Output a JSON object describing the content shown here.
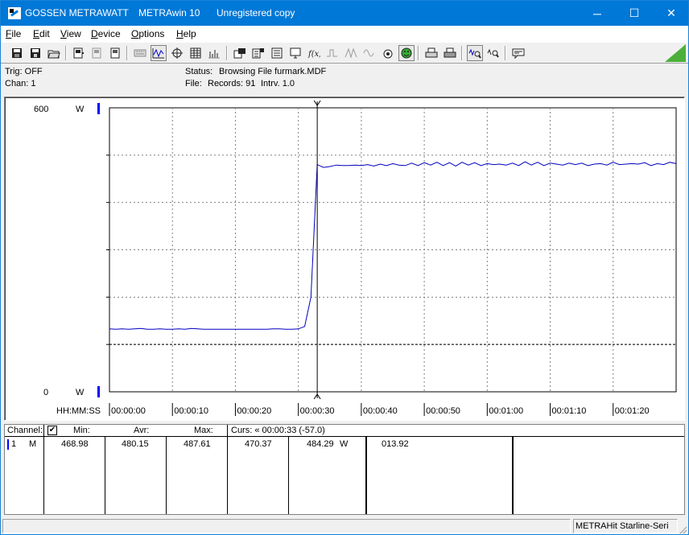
{
  "window": {
    "title_parts": [
      "GOSSEN METRAWATT",
      "METRAwin 10",
      "Unregistered copy"
    ],
    "controls": {
      "minimize": "─",
      "maximize": "☐",
      "close": "✕"
    }
  },
  "menu": [
    {
      "label": "File",
      "key": "F",
      "rest": "ile"
    },
    {
      "label": "Edit",
      "key": "E",
      "rest": "dit"
    },
    {
      "label": "View",
      "key": "V",
      "rest": "iew"
    },
    {
      "label": "Device",
      "key": "D",
      "rest": "evice"
    },
    {
      "label": "Options",
      "key": "O",
      "rest": "ptions"
    },
    {
      "label": "Help",
      "key": "H",
      "rest": "elp"
    }
  ],
  "toolbar": {
    "icons": [
      "save-icon",
      "save-as-icon",
      "open-icon",
      "device-icon",
      "device-2-icon",
      "device-3-icon",
      "keyboard-icon",
      "waveform-icon",
      "crosshair-icon",
      "table-icon",
      "bars-icon",
      "export-icon",
      "export-2-icon",
      "list-icon",
      "monitor-icon",
      "function-icon",
      "trigger-icon",
      "peak-icon",
      "sine-icon",
      "camera-icon",
      "smiley-icon",
      "print-icon",
      "print-2-icon",
      "zoom-icon",
      "zoom-2-icon",
      "comment-icon"
    ],
    "pressed": [
      "waveform-icon",
      "smiley-icon",
      "zoom-icon"
    ]
  },
  "status": {
    "trig": "Trig: OFF",
    "chan": "Chan:  1",
    "status_label": "Status:",
    "status_value": "Browsing File furmark.MDF",
    "file_label": "File:",
    "file_records": "Records: 91",
    "file_intrv": "Intrv. 1.0"
  },
  "chart_data": {
    "type": "line",
    "y_axis": {
      "max_label": "600",
      "min_label": "0",
      "unit": "W",
      "ylim": [
        0,
        600
      ]
    },
    "x_axis": {
      "label": "HH:MM:SS",
      "ticks": [
        "00:00:00",
        "00:00:10",
        "00:00:20",
        "00:00:30",
        "00:00:40",
        "00:00:50",
        "00:01:00",
        "00:01:10",
        "00:01:20"
      ],
      "xlim": [
        0,
        90
      ]
    },
    "cursor": {
      "x": 33
    },
    "threshold": {
      "y": 100
    },
    "grid": true,
    "series": [
      {
        "color": "#0000c0",
        "x": [
          0,
          1,
          2,
          3,
          4,
          5,
          6,
          7,
          8,
          9,
          10,
          11,
          12,
          13,
          14,
          15,
          16,
          17,
          18,
          19,
          20,
          21,
          22,
          23,
          24,
          25,
          26,
          27,
          28,
          29,
          30,
          31,
          32,
          33,
          34,
          35,
          36,
          37,
          38,
          39,
          40,
          41,
          42,
          43,
          44,
          45,
          46,
          47,
          48,
          49,
          50,
          51,
          52,
          53,
          54,
          55,
          56,
          57,
          58,
          59,
          60,
          61,
          62,
          63,
          64,
          65,
          66,
          67,
          68,
          69,
          70,
          71,
          72,
          73,
          74,
          75,
          76,
          77,
          78,
          79,
          80,
          81,
          82,
          83,
          84,
          85,
          86,
          87,
          88,
          89,
          90
        ],
        "values": [
          133,
          132,
          133,
          132,
          133,
          134,
          132,
          132,
          133,
          132,
          132,
          133,
          132,
          134,
          133,
          132,
          132,
          132,
          132,
          132,
          132,
          132,
          132,
          132,
          132,
          132,
          133,
          133,
          132,
          132,
          133,
          138,
          200,
          480,
          474,
          476,
          479,
          478,
          478,
          479,
          478,
          480,
          477,
          481,
          478,
          482,
          479,
          478,
          483,
          478,
          484,
          479,
          485,
          478,
          484,
          477,
          485,
          479,
          484,
          478,
          482,
          480,
          481,
          479,
          483,
          478,
          486,
          479,
          485,
          478,
          483,
          481,
          479,
          483,
          480,
          483,
          478,
          481,
          482,
          479,
          485,
          480,
          481,
          482,
          481,
          484,
          478,
          482,
          480,
          485,
          482
        ]
      }
    ]
  },
  "table": {
    "headers": {
      "channel": "Channel:",
      "check": "✔",
      "min": "Min:",
      "avr": "Avr:",
      "max": "Max:",
      "cursor": "Curs: « 00:00:33 (-57.0)"
    },
    "row": {
      "num": "1",
      "type": "M",
      "min": "468.98",
      "avr": "480.15",
      "max": "487.61",
      "curs1": "470.37",
      "curs2": "484.29",
      "unit": "W",
      "extra": "013.92"
    }
  },
  "bottom_status": {
    "device": "METRAHit Starline-Seri"
  }
}
